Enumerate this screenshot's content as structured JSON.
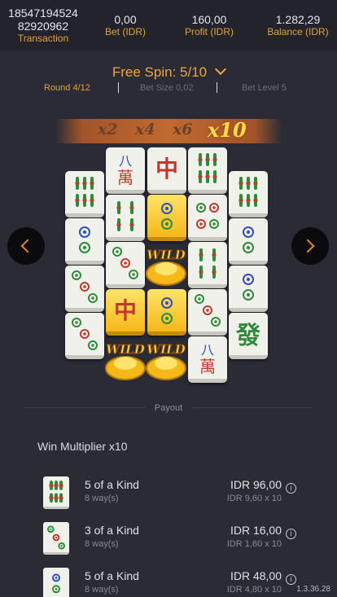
{
  "header": {
    "transaction_id_line1": "18547194524",
    "transaction_id_line2": "82920962",
    "transaction_label": "Transaction",
    "bet_value": "0,00",
    "bet_label": "Bet (IDR)",
    "profit_value": "160,00",
    "profit_label": "Profit (IDR)",
    "balance_value": "1.282,29",
    "balance_label": "Balance (IDR)"
  },
  "spin": {
    "free_spin": "Free Spin: 5/10",
    "round": "Round 4/12",
    "bet_size": "Bet Size 0,02",
    "bet_level": "Bet Level 5"
  },
  "multipliers": [
    "x2",
    "x4",
    "x6",
    "x10"
  ],
  "active_multiplier": "x10",
  "reel_symbols": {
    "wild_text": "WILD",
    "wan_upper": "八",
    "wan_lower": "萬",
    "red_dragon": "中",
    "green_dragon": "發"
  },
  "payout": {
    "section_label": "Payout",
    "win_multiplier": "Win Multiplier x10",
    "rows": [
      {
        "kind": "5 of a Kind",
        "ways": "8 way(s)",
        "amount": "IDR 96,00",
        "calc": "IDR 9,60 x 10",
        "icon": "bamboo-tile-icon"
      },
      {
        "kind": "3 of a Kind",
        "ways": "8 way(s)",
        "amount": "IDR 16,00",
        "calc": "IDR 1,60 x 10",
        "icon": "three-dot-tile-icon"
      },
      {
        "kind": "5 of a Kind",
        "ways": "8 way(s)",
        "amount": "IDR 48,00",
        "calc": "IDR 4,80 x 10",
        "icon": "two-dot-tile-icon"
      }
    ],
    "info_glyph": "i"
  },
  "version": "1.3.36.28",
  "colors": {
    "accent": "#f0a43a",
    "background": "#2b2b36",
    "header_bg": "#23232c",
    "gold": "#f5b818"
  }
}
